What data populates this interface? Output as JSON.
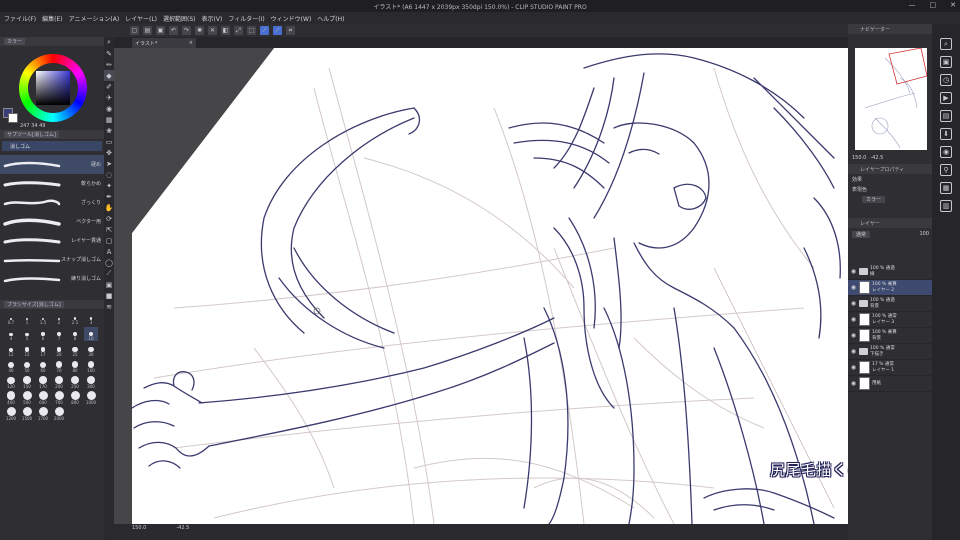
{
  "titlebar": {
    "title": "イラスト* (A6 1447 x 2039px 350dpi 150.0%) - CLIP STUDIO PAINT PRO",
    "minimize": "—",
    "maximize": "□",
    "close": "✕"
  },
  "menu": [
    "ファイル(F)",
    "編集(E)",
    "アニメーション(A)",
    "レイヤー(L)",
    "選択範囲(S)",
    "表示(V)",
    "フィルター(I)",
    "ウィンドウ(W)",
    "ヘルプ(H)"
  ],
  "left": {
    "color_tab": "カラー",
    "hsv_readout": "247 34 49",
    "subtool_tab": "サブツール[消しゴム]",
    "subtool_group": "消しゴム",
    "brushes": [
      "硬め",
      "軟らかめ",
      "ざっくり",
      "ベクター用",
      "レイヤー貫通",
      "スナップ消しゴム",
      "練り消しゴム"
    ],
    "size_tab": "ブラシサイズ[消しゴム]",
    "sizes": [
      "0.7",
      "1",
      "1.5",
      "2",
      "2.5",
      "3",
      "4",
      "5",
      "6",
      "7",
      "8",
      "10",
      "12",
      "15",
      "17",
      "20",
      "25",
      "30",
      "40",
      "50",
      "60",
      "70",
      "80",
      "100",
      "120",
      "150",
      "170",
      "200",
      "250",
      "300",
      "400",
      "500",
      "600",
      "700",
      "800",
      "1000",
      "1200",
      "1500",
      "1700",
      "2000"
    ],
    "selected_size": "10"
  },
  "canvas": {
    "tab_label": "イラスト*",
    "tab_close": "×",
    "status_zoom": "150.0",
    "status_angle": "-42.5",
    "subtitle": "尻尾毛描くの楽しい"
  },
  "right": {
    "navigator_tab": "ナビゲーター",
    "nav_zoom": "150.0",
    "nav_angle": "-42.5",
    "effect_tab": "レイヤープロパティ",
    "effect_label": "効果",
    "display_color_label": "表現色",
    "display_color_value": "カラー",
    "layer_tab": "レイヤー",
    "blend_mode": "通常",
    "opacity": "100",
    "layers": [
      {
        "lines": [
          "100 % 通過",
          "線"
        ],
        "type": "folder",
        "sel": false
      },
      {
        "lines": [
          "100 % 乗算",
          "レイヤー 2"
        ],
        "type": "layer",
        "sel": true
      },
      {
        "lines": [
          "100 % 通過",
          "背景"
        ],
        "type": "folder",
        "sel": false
      },
      {
        "lines": [
          "100 % 通常",
          "レイヤー 3"
        ],
        "type": "layer",
        "sel": false
      },
      {
        "lines": [
          "100 % 乗算",
          "背景"
        ],
        "type": "layer",
        "sel": false
      },
      {
        "lines": [
          "100 % 通常",
          "下描き"
        ],
        "type": "folder",
        "sel": false
      },
      {
        "lines": [
          "17 % 通常",
          "レイヤー 1"
        ],
        "type": "layer",
        "sel": false
      },
      {
        "lines": [
          "用紙"
        ],
        "type": "paper",
        "sel": false
      }
    ]
  },
  "colors": {
    "line_art": "#3a3a6e",
    "sketch": "#c9bebe",
    "accent": "#4a6fd0"
  }
}
